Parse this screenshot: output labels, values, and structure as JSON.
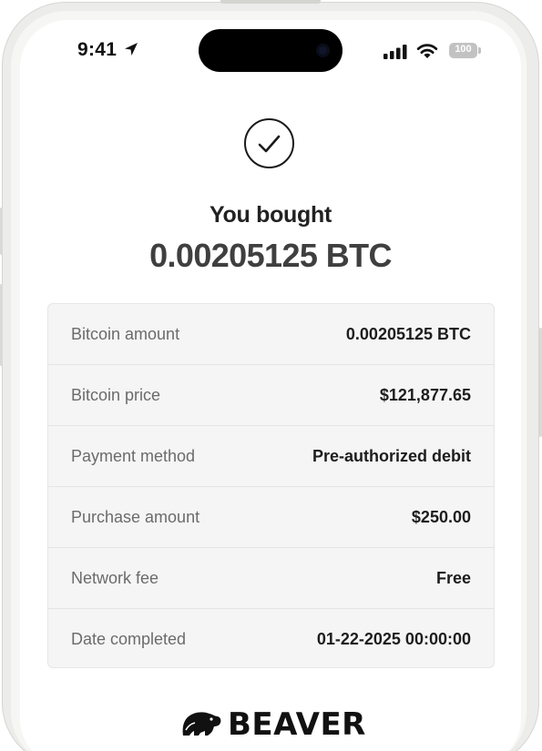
{
  "status_bar": {
    "time": "9:41",
    "battery_level": "100"
  },
  "confirmation": {
    "icon": "check-circle-icon",
    "headline": "You bought",
    "amount": "0.00205125 BTC"
  },
  "details": [
    {
      "label": "Bitcoin amount",
      "value": "0.00205125 BTC"
    },
    {
      "label": "Bitcoin price",
      "value": "$121,877.65"
    },
    {
      "label": "Payment method",
      "value": "Pre-authorized debit"
    },
    {
      "label": "Purchase amount",
      "value": "$250.00"
    },
    {
      "label": "Network fee",
      "value": "Free"
    },
    {
      "label": "Date completed",
      "value": "01-22-2025 00:00:00"
    }
  ],
  "brand": {
    "name": "BEAVER",
    "logo_icon": "beaver-logo-icon"
  }
}
